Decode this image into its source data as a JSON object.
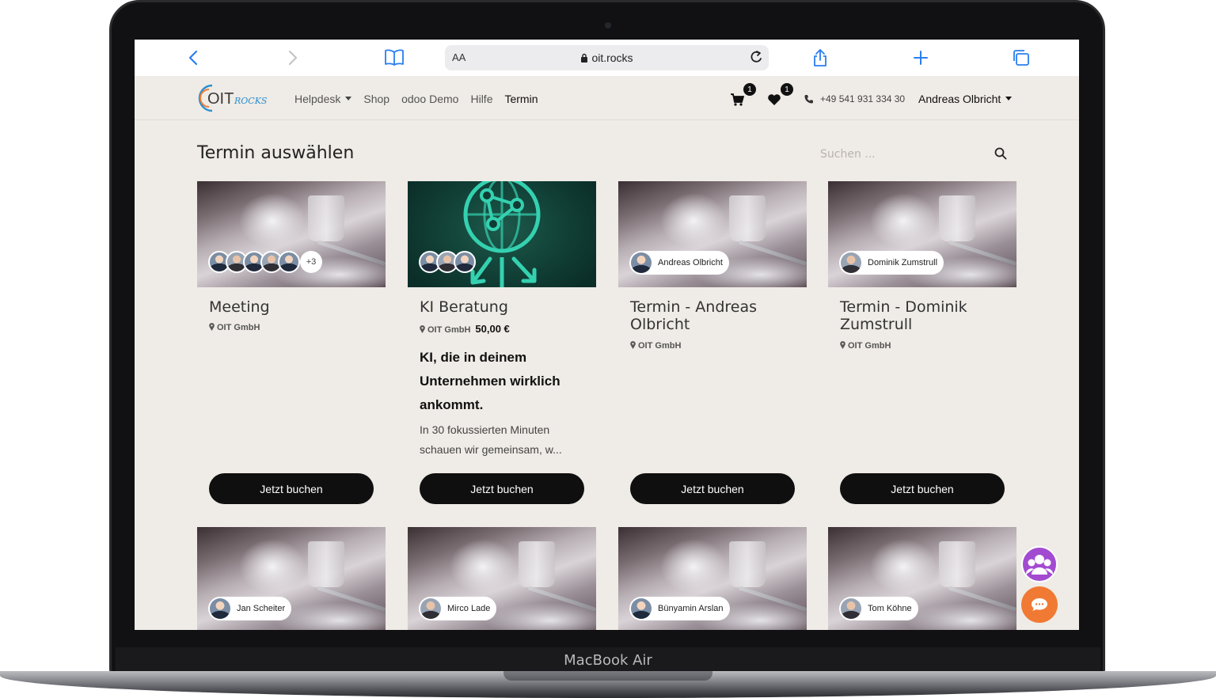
{
  "device": {
    "label": "MacBook Air"
  },
  "browser": {
    "text_size_label": "AA",
    "url": "oit.rocks"
  },
  "site": {
    "logo_text": "OIT",
    "logo_script": "ROCKS",
    "nav": [
      {
        "label": "Helpdesk",
        "has_dropdown": true
      },
      {
        "label": "Shop"
      },
      {
        "label": "odoo Demo"
      },
      {
        "label": "Hilfe"
      },
      {
        "label": "Termin",
        "active": true
      }
    ],
    "cart_count": "1",
    "wishlist_count": "1",
    "phone": "+49 541 931 334 30",
    "user": "Andreas Olbricht"
  },
  "page": {
    "title": "Termin auswählen",
    "search_placeholder": "Suchen ..."
  },
  "cards": [
    {
      "title": "Meeting",
      "location": "OIT GmbH",
      "extra_count": "+3",
      "button": "Jetzt buchen"
    },
    {
      "title": "KI Beratung",
      "location": "OIT GmbH",
      "price": "50,00 €",
      "heading": "KI, die in deinem Unternehmen wirklich ankommt.",
      "description": "In 30 fokussierten Minuten schauen wir gemeinsam, w...",
      "button": "Jetzt buchen"
    },
    {
      "title": "Termin - Andreas Olbricht",
      "location": "OIT GmbH",
      "person": "Andreas Olbricht",
      "button": "Jetzt buchen"
    },
    {
      "title": "Termin - Dominik Zumstrull",
      "location": "OIT GmbH",
      "person": "Dominik Zumstrull",
      "button": "Jetzt buchen"
    }
  ],
  "cards_row2": [
    {
      "person": "Jan Scheiter"
    },
    {
      "person": "Mirco Lade"
    },
    {
      "person": "Bünyamin Arslan"
    },
    {
      "person": "Tom Köhne"
    }
  ],
  "colors": {
    "page_bg": "#efebe6",
    "button_bg": "#0f0f0f",
    "accent_purple": "#a24bd1",
    "accent_orange": "#f07a33",
    "ki_green": "#34d1b0"
  }
}
